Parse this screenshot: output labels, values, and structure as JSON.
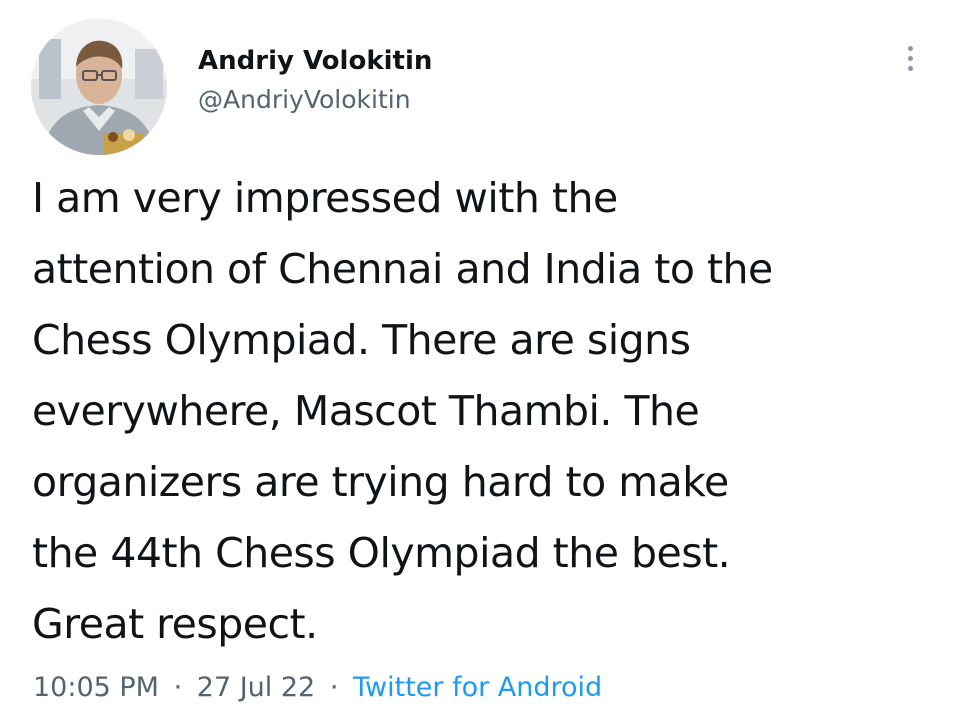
{
  "author": {
    "display_name": "Andriy Volokitin",
    "handle": "@AndriyVolokitin"
  },
  "tweet": {
    "lines": [
      "I am very impressed with the",
      "attention of Chennai and India to the",
      "Chess Olympiad. There are signs",
      "everywhere, Mascot Thambi. The",
      "organizers are trying hard to make",
      "the 44th Chess Olympiad the best.",
      "Great respect."
    ]
  },
  "meta": {
    "time": "10:05 PM",
    "separator": "·",
    "date": "27 Jul 22",
    "source": "Twitter for Android"
  },
  "icons": {
    "more": "more-vertical-icon",
    "avatar": "profile-photo"
  },
  "colors": {
    "text_primary": "#0f1419",
    "text_secondary": "#536471",
    "link": "#1d9bf0"
  }
}
